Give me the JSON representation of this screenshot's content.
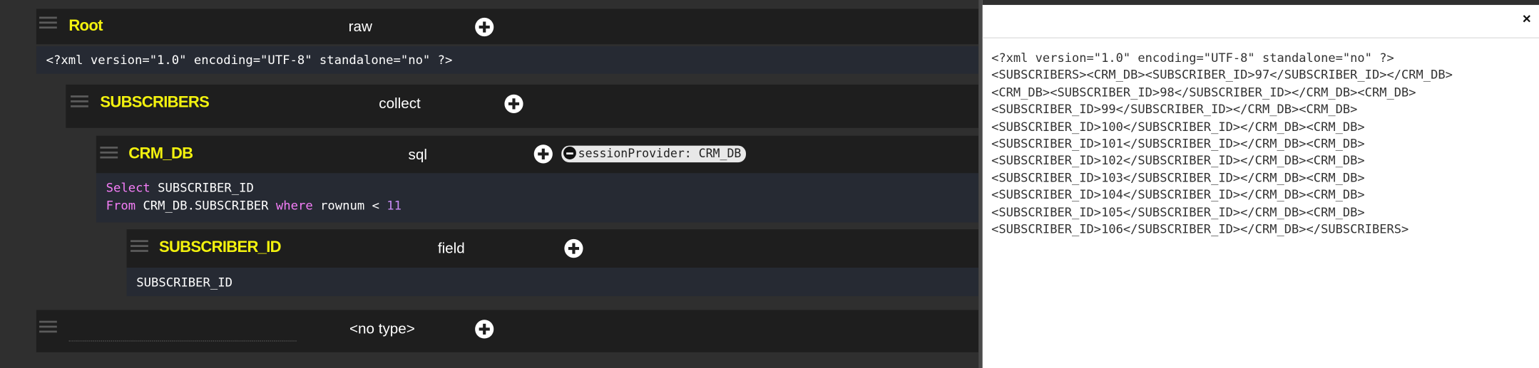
{
  "nodes": {
    "root": {
      "name": "Root",
      "type": "raw",
      "body": "<?xml version=\"1.0\" encoding=\"UTF-8\" standalone=\"no\" ?>"
    },
    "subscribers": {
      "name": "SUBSCRIBERS",
      "type": "collect"
    },
    "crm_db": {
      "name": "CRM_DB",
      "type": "sql",
      "attribute": "sessionProvider: CRM_DB",
      "sql": {
        "kw_select": "Select",
        "select_field": "SUBSCRIBER_ID",
        "kw_from": "From",
        "table": "CRM_DB.SUBSCRIBER",
        "kw_where": "where",
        "condition": "rownum <",
        "limit": "11"
      }
    },
    "subscriber_id": {
      "name": "SUBSCRIBER_ID",
      "type": "field",
      "body": "SUBSCRIBER_ID"
    },
    "new_node": {
      "name": "",
      "type": "<no type>"
    }
  },
  "output": {
    "close_label": "×",
    "lines": [
      "<?xml version=\"1.0\" encoding=\"UTF-8\" standalone=\"no\" ?>",
      "<SUBSCRIBERS><CRM_DB><SUBSCRIBER_ID>97</SUBSCRIBER_ID></CRM_DB>",
      "<CRM_DB><SUBSCRIBER_ID>98</SUBSCRIBER_ID></CRM_DB><CRM_DB>",
      "<SUBSCRIBER_ID>99</SUBSCRIBER_ID></CRM_DB><CRM_DB>",
      "<SUBSCRIBER_ID>100</SUBSCRIBER_ID></CRM_DB><CRM_DB>",
      "<SUBSCRIBER_ID>101</SUBSCRIBER_ID></CRM_DB><CRM_DB>",
      "<SUBSCRIBER_ID>102</SUBSCRIBER_ID></CRM_DB><CRM_DB>",
      "<SUBSCRIBER_ID>103</SUBSCRIBER_ID></CRM_DB><CRM_DB>",
      "<SUBSCRIBER_ID>104</SUBSCRIBER_ID></CRM_DB><CRM_DB>",
      "<SUBSCRIBER_ID>105</SUBSCRIBER_ID></CRM_DB><CRM_DB>",
      "<SUBSCRIBER_ID>106</SUBSCRIBER_ID></CRM_DB></SUBSCRIBERS>"
    ]
  },
  "colors": {
    "node_name": "#f3f20e",
    "keyword": "#f57ef8",
    "number": "#c98cf6",
    "panel_bg": "#2f2f2f",
    "header_bg": "#1e1e1e",
    "code_bg": "#262a33"
  },
  "icons": [
    "drag-handle-icon",
    "plus-icon",
    "minus-icon",
    "close-icon"
  ]
}
